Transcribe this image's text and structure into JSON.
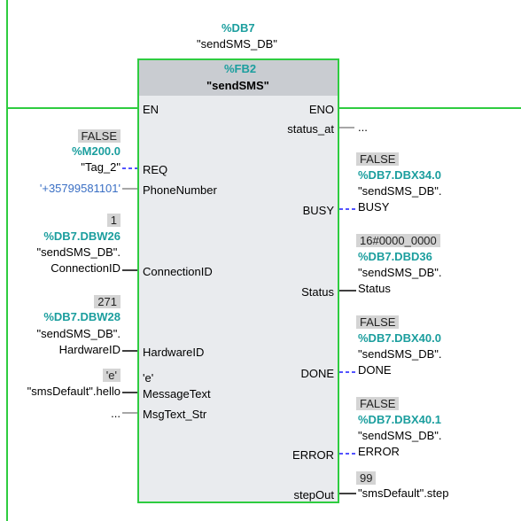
{
  "instance_db": {
    "address": "%DB7",
    "name": "\"sendSMS_DB\""
  },
  "block": {
    "address": "%FB2",
    "name": "\"sendSMS\""
  },
  "pins": {
    "en": "EN",
    "eno": "ENO",
    "req": "REQ",
    "phone": "PhoneNumber",
    "connection_id": "ConnectionID",
    "hardware_id": "HardwareID",
    "message_text": "MessageText",
    "msgtext_str": "MsgText_Str",
    "status_at": "status_at",
    "busy": "BUSY",
    "status": "Status",
    "done": "DONE",
    "error": "ERROR",
    "step_out": "stepOut"
  },
  "inputs": {
    "req": {
      "value": "FALSE",
      "address": "%M200.0",
      "tag": "\"Tag_2\""
    },
    "phone": {
      "constant": "'+35799581101'"
    },
    "connection_id": {
      "value": "1",
      "address": "%DB7.DBW26",
      "tag_line1": "\"sendSMS_DB\".",
      "tag_line2": "ConnectionID"
    },
    "hardware_id": {
      "value": "271",
      "address": "%DB7.DBW28",
      "tag_line1": "\"sendSMS_DB\".",
      "tag_line2": "HardwareID"
    },
    "message_text": {
      "value": "'e'",
      "inner_value": "'e'",
      "tag": "\"smsDefault\".hello"
    },
    "msgtext_str": {
      "tag": "..."
    }
  },
  "outputs": {
    "status_at": {
      "tag": "..."
    },
    "busy": {
      "value": "FALSE",
      "address": "%DB7.DBX34.0",
      "tag_line1": "\"sendSMS_DB\".",
      "tag_line2": "BUSY"
    },
    "status": {
      "value": "16#0000_0000",
      "address": "%DB7.DBD36",
      "tag_line1": "\"sendSMS_DB\".",
      "tag_line2": "Status"
    },
    "done": {
      "value": "FALSE",
      "address": "%DB7.DBX40.0",
      "tag_line1": "\"sendSMS_DB\".",
      "tag_line2": "DONE"
    },
    "error": {
      "value": "FALSE",
      "address": "%DB7.DBX40.1",
      "tag_line1": "\"sendSMS_DB\".",
      "tag_line2": "ERROR"
    },
    "step_out": {
      "value": "99",
      "tag": "\"smsDefault\".step"
    }
  },
  "colors": {
    "power_flow": "#2ecc40",
    "address": "#1b9e9e",
    "boolean_wire": "#1a1aff",
    "constant": "#3a6fc4"
  }
}
